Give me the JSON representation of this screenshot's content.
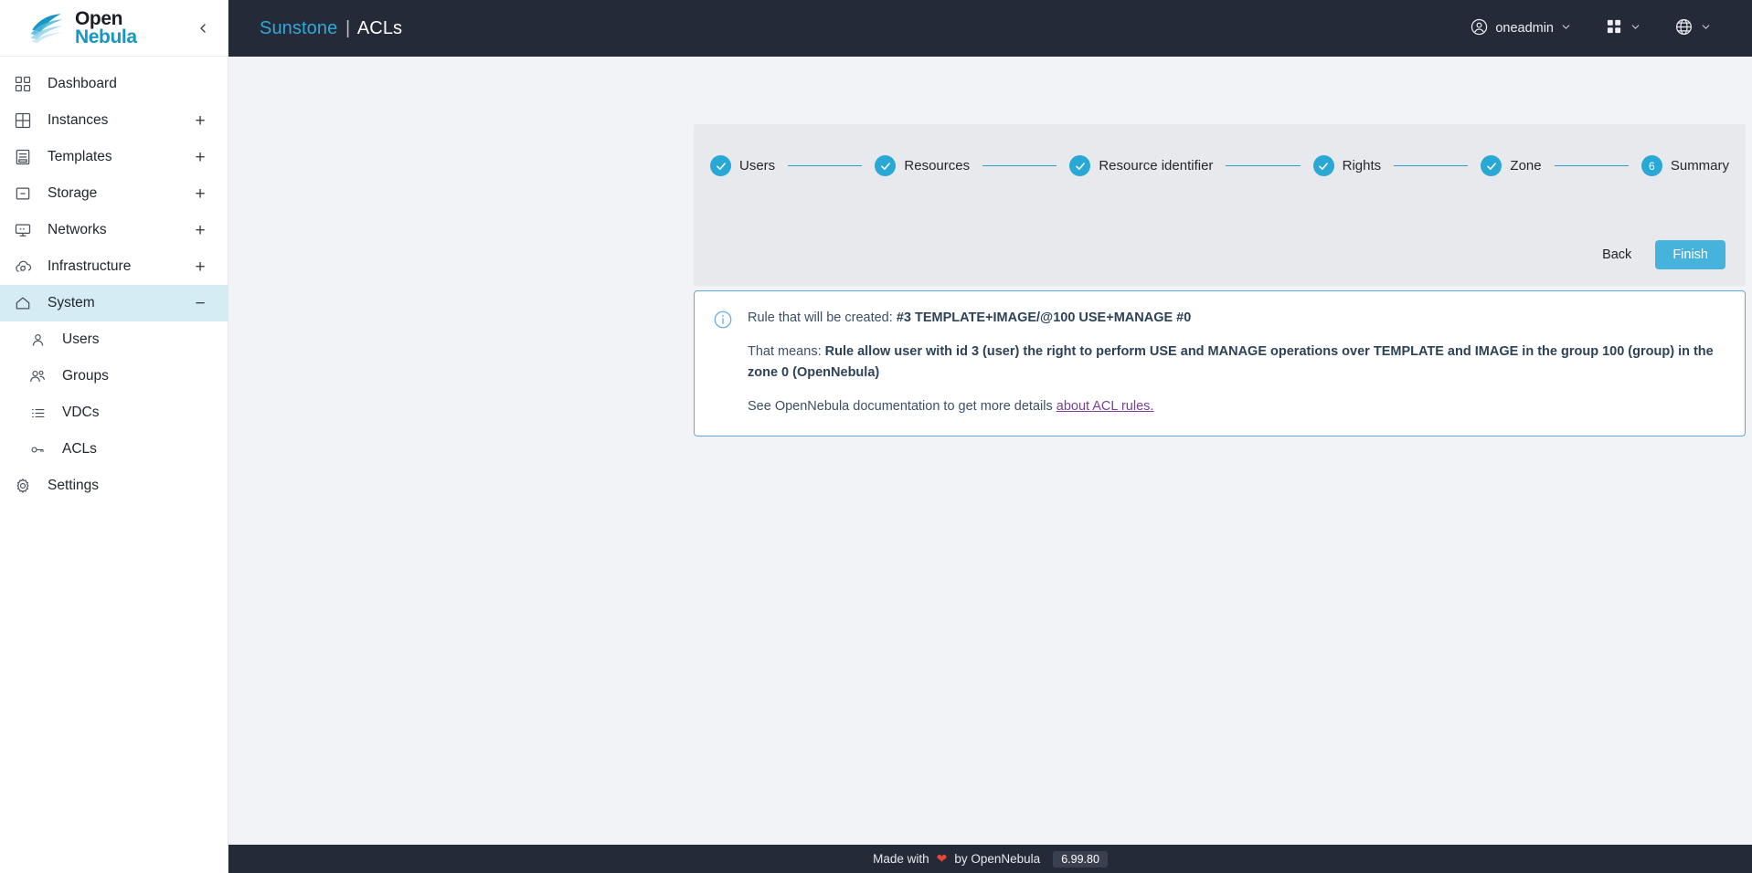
{
  "brand": {
    "logo_line1": "Open",
    "logo_line2": "Nebula",
    "accent": "#1796c4"
  },
  "sidebar": {
    "collapse_icon": "chevron-left-icon",
    "items": [
      {
        "label": "Dashboard",
        "icon": "dashboard-icon",
        "expander": "",
        "active": false
      },
      {
        "label": "Instances",
        "icon": "grid-icon",
        "expander": "+",
        "active": false
      },
      {
        "label": "Templates",
        "icon": "template-icon",
        "expander": "+",
        "active": false
      },
      {
        "label": "Storage",
        "icon": "storage-icon",
        "expander": "+",
        "active": false
      },
      {
        "label": "Networks",
        "icon": "network-icon",
        "expander": "+",
        "active": false
      },
      {
        "label": "Infrastructure",
        "icon": "cloud-icon",
        "expander": "+",
        "active": false
      },
      {
        "label": "System",
        "icon": "home-icon",
        "expander": "−",
        "active": true
      }
    ],
    "subitems": [
      {
        "label": "Users",
        "icon": "user-icon"
      },
      {
        "label": "Groups",
        "icon": "users-icon"
      },
      {
        "label": "VDCs",
        "icon": "list-icon"
      },
      {
        "label": "ACLs",
        "icon": "key-icon"
      },
      {
        "label": "Settings",
        "icon": "gear-icon"
      }
    ]
  },
  "topbar": {
    "brand_title": "Sunstone",
    "separator": "|",
    "page_title": "ACLs",
    "user": "oneadmin",
    "user_icon": "account-circle-icon",
    "apps_icon": "apps-grid-icon",
    "language_icon": "globe-icon",
    "caret": "⌄"
  },
  "wizard": {
    "steps": [
      {
        "label": "Users",
        "number": "1",
        "state": "done"
      },
      {
        "label": "Resources",
        "number": "2",
        "state": "done"
      },
      {
        "label": "Resource identifier",
        "number": "3",
        "state": "done"
      },
      {
        "label": "Rights",
        "number": "4",
        "state": "done"
      },
      {
        "label": "Zone",
        "number": "5",
        "state": "done"
      },
      {
        "label": "Summary",
        "number": "6",
        "state": "current"
      }
    ],
    "back_label": "Back",
    "finish_label": "Finish",
    "step_color": "#29a8d6"
  },
  "alert": {
    "icon": "info-circle-icon",
    "line1_prefix": "Rule that will be created: ",
    "line1_rule": "#3 TEMPLATE+IMAGE/@100 USE+MANAGE #0",
    "line2_prefix": "That means: ",
    "line2_meaning": "Rule allow user with id 3 (user) the right to perform USE and MANAGE operations over TEMPLATE and IMAGE in the group 100 (group) in the zone 0 (OpenNebula)",
    "line3_prefix": "See OpenNebula documentation to get more details ",
    "line3_link": "about ACL rules.",
    "border_color": "#5aa9ec",
    "link_color": "#7b3f98"
  },
  "footer": {
    "made_with": "Made with",
    "heart": "❤",
    "by": "by OpenNebula",
    "version": "6.99.80"
  }
}
